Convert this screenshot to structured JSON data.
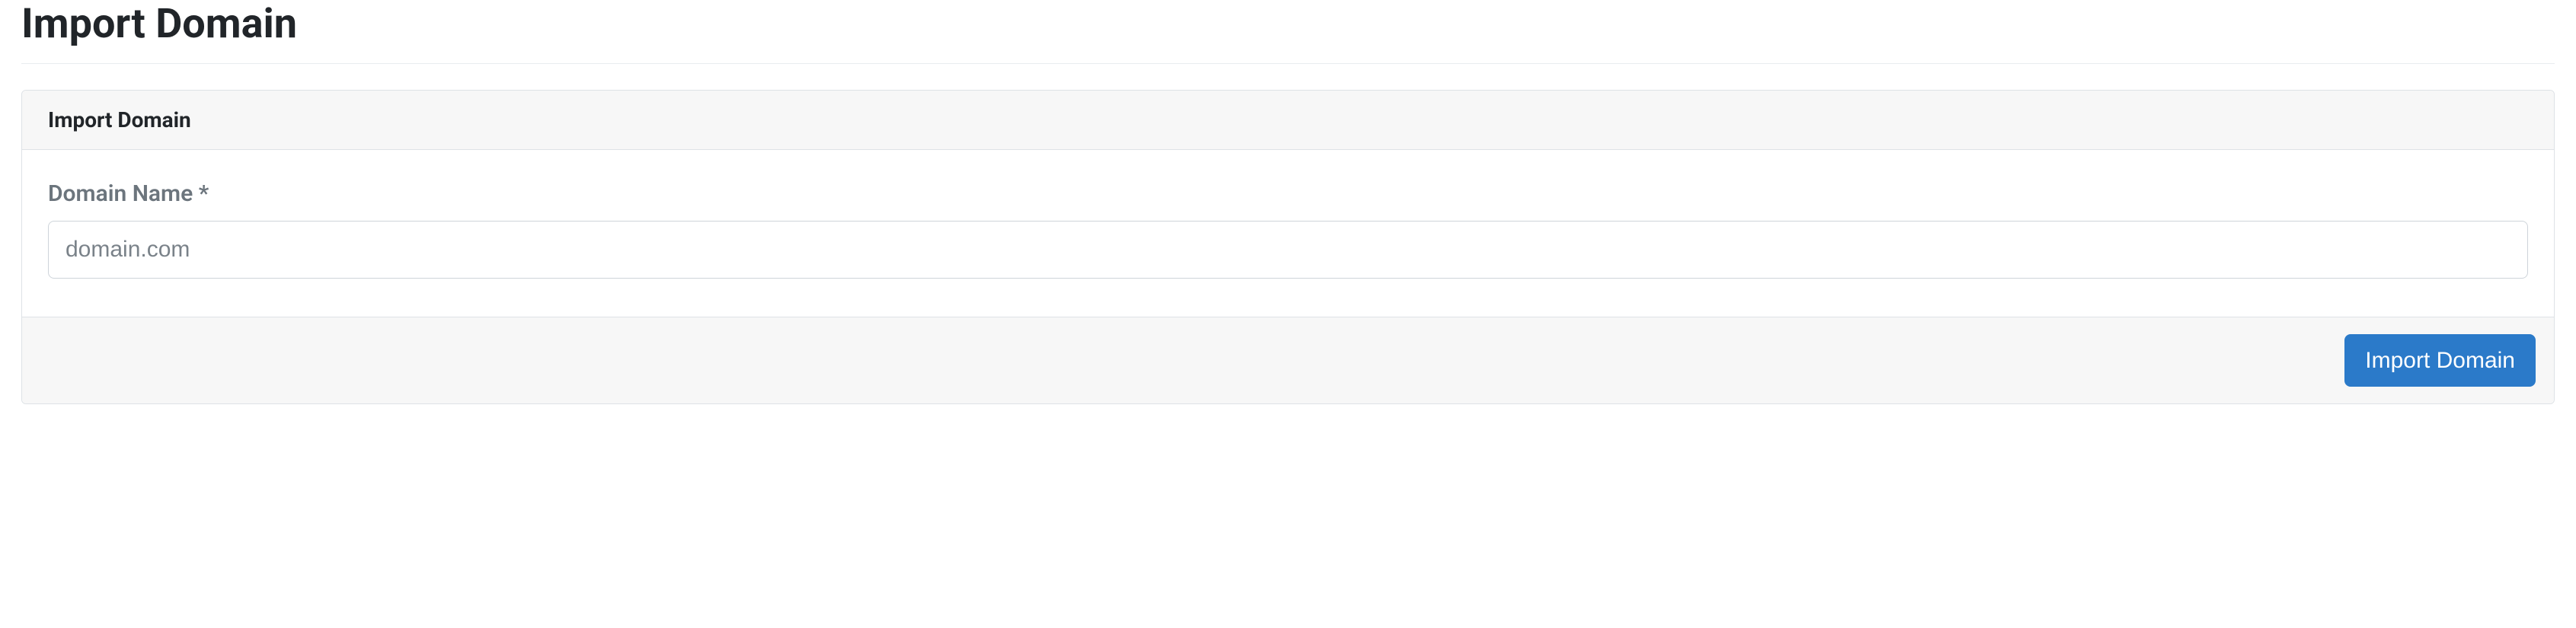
{
  "page": {
    "title": "Import Domain"
  },
  "panel": {
    "header": "Import Domain"
  },
  "form": {
    "domain_name": {
      "label": "Domain Name *",
      "placeholder": "domain.com",
      "value": ""
    }
  },
  "actions": {
    "submit_label": "Import Domain"
  }
}
